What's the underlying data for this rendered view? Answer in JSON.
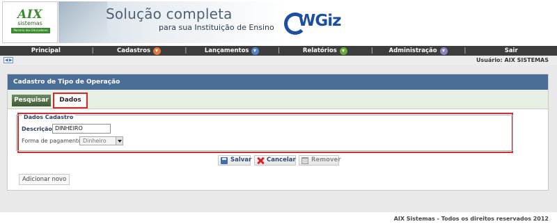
{
  "header": {
    "logo_name": "AIX",
    "logo_sub": "sistemas",
    "logo_tagline": "Parceria dos Educadores",
    "headline": "Solução completa",
    "subline": "para sua Instituição de Ensino",
    "brand": "WGiz"
  },
  "nav": {
    "items": [
      {
        "label": "Principal",
        "icon": null
      },
      {
        "label": "Cadastros",
        "icon": "chevron-down-icon",
        "icon_color": "#e07b3a"
      },
      {
        "label": "Lançamentos",
        "icon": "chevron-down-icon",
        "icon_color": "#4f85c7"
      },
      {
        "label": "Relatórios",
        "icon": "chevron-down-icon",
        "icon_color": "#6aab3c"
      },
      {
        "label": "Administração",
        "icon": "chevron-down-icon",
        "icon_color": "#8a86c4"
      },
      {
        "label": "Sair",
        "icon": null
      }
    ]
  },
  "userbar": {
    "expand_icon": "expand-arrows-icon",
    "user_label": "Usuário: AIX SISTEMAS"
  },
  "panel": {
    "title": "Cadastro de Tipo de Operação",
    "tabs": [
      {
        "label": "Pesquisar",
        "active": false
      },
      {
        "label": "Dados",
        "active": true
      }
    ],
    "fieldset": {
      "legend": "Dados Cadastro",
      "descricao_label": "Descrição :",
      "descricao_value": "DINHEIRO",
      "forma_label": "Forma de pagamento :",
      "forma_value": "Dinheiro"
    },
    "actions": {
      "save_label": "Salvar",
      "cancel_label": "Cancelar",
      "remove_label": "Remover"
    },
    "add_label": "Adicionar novo"
  },
  "footer": {
    "text": "AIX Sistemas - Todos os direitos reservados 2012"
  },
  "colors": {
    "nav_bg": "#3d3d3d",
    "panel_title_bg": "#4b6e96",
    "highlight_outline": "#d42a2a",
    "tab_active_bg": "#415a38"
  }
}
